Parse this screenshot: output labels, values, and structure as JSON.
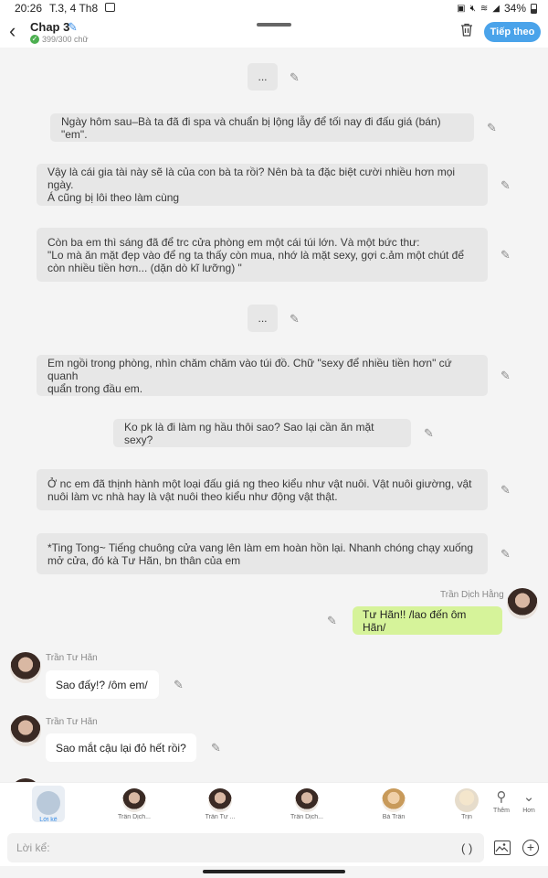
{
  "status_bar": {
    "time": "20:26",
    "date": "T.3, 4 Th8",
    "battery": "34%"
  },
  "header": {
    "title": "Chap 3",
    "word_count": "399/300 chữ",
    "next_label": "Tiếp theo"
  },
  "messages": {
    "m1": "...",
    "m2": "Ngày hôm sau–Bà ta đã đi spa và chuẩn bị lộng lẫy để tối nay đi đấu giá (bán) \"em\".",
    "m3": "Vậy là cái gia tài này sẽ là của con bà ta rồi? Nên bà ta đặc biệt cười nhiều hơn mọi ngày.\nÁ cũng bị lôi theo làm cùng",
    "m4": "Còn ba em thì sáng đã để trc cửa phòng em một cái túi lớn. Và một bức thư:\n\"Lo mà ăn mặt đẹp vào để ng ta thấy còn mua, nhớ là mặt sexy, gợi c.ảm một chút để\ncòn nhiều tiền hơn... (dặn dò kĩ lưỡng) \"",
    "m5": "...",
    "m6": "Em ngồi trong phòng, nhìn chăm chăm vào túi đồ. Chữ \"sexy để nhiều tiền hơn\" cứ quanh\nquẩn trong đầu em.",
    "m7": "Ko pk là đi làm ng hầu thôi sao? Sao lại cần ăn mặt sexy?",
    "m8": "Ở nc em đã thịnh hành một loại đấu giá ng theo kiểu như vật nuôi. Vật nuôi giường, vật\nnuôi làm vc nhà hay là vật nuôi theo kiểu như động vật thật.",
    "m9": "*Ting Tong~ Tiếng chuông cửa vang lên làm em hoàn hồn lại. Nhanh chóng chạy xuống\nmở cửa, đó kà Tư Hãn, bn thân của em",
    "m10_name": "Trần Dịch Hằng",
    "m10": "Tư Hãn!! /lao đến ôm Hãn/",
    "m11_name": "Trần Tư Hãn",
    "m11": "Sao đấy!? /ôm em/",
    "m12_name": "Trần Tư Hãn",
    "m12": "Sao mắt cậu lại đỏ hết rồi?"
  },
  "characters": {
    "c0": "Lời kể",
    "c1": "Trần Dịch...",
    "c2": "Trần Tư ...",
    "c3": "Trần Dịch...",
    "c4": "Bà Trần",
    "c5": "Trịn",
    "more_label": "Thêm",
    "less_label": "Hơn"
  },
  "input": {
    "placeholder": "Lời kể:",
    "paren": "( )"
  },
  "colors": {
    "accent": "#4aa3ea",
    "self_bubble": "#d6f39a",
    "narration_bubble": "#e7e7e7"
  }
}
